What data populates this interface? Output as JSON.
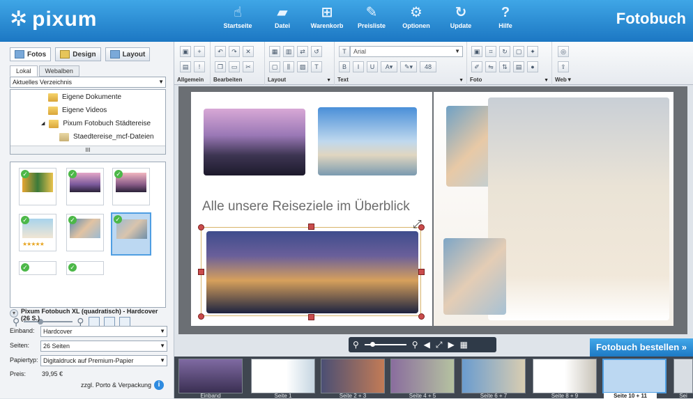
{
  "app": {
    "logo": "pixum",
    "brand": "Fotobuch"
  },
  "nav": [
    {
      "label": "Startseite",
      "icon": "hand-pointer-icon"
    },
    {
      "label": "Datei",
      "icon": "folder-icon"
    },
    {
      "label": "Warenkorb",
      "icon": "cart-icon"
    },
    {
      "label": "Preisliste",
      "icon": "price-tag-icon"
    },
    {
      "label": "Optionen",
      "icon": "gears-icon"
    },
    {
      "label": "Update",
      "icon": "refresh-icon"
    },
    {
      "label": "Hilfe",
      "icon": "question-icon"
    }
  ],
  "sidebar": {
    "tabs": [
      "Fotos",
      "Design",
      "Layout"
    ],
    "subtabs": [
      "Lokal",
      "Webalben"
    ],
    "directory": "Aktuelles Verzeichnis",
    "tree": [
      "Eigene Dokumente",
      "Eigene Videos",
      "Pixum Fotobuch Städtereise",
      "Staedtereise_mcf-Dateien"
    ],
    "scroll_mid": "III"
  },
  "product": {
    "title": "Pixum Fotobuch XL (quadratisch) - Hardcover (26 S.)",
    "einband_label": "Einband:",
    "einband_value": "Hardcover",
    "seiten_label": "Seiten:",
    "seiten_value": "26 Seiten",
    "papier_label": "Papiertyp:",
    "papier_value": "Digitaldruck auf Premium-Papier",
    "preis_label": "Preis:",
    "preis_value": "39,95 €",
    "porto": "zzgl. Porto & Verpackung"
  },
  "toolbar": {
    "groups": [
      "Allgemein",
      "Bearbeiten",
      "Layout",
      "Text",
      "Foto",
      "Web"
    ],
    "font": "Arial",
    "fontsize": "48"
  },
  "page": {
    "title_text": "Alle unsere Reiseziele im Überblick"
  },
  "order_button": "Fotobuch bestellen »",
  "pages": [
    "Einband",
    "Seite 1",
    "Seite 2 + 3",
    "Seite 4 + 5",
    "Seite 6 + 7",
    "Seite 8 + 9",
    "Seite 10 + 11",
    "Sei"
  ],
  "colors": {
    "accent": "#1c77c3",
    "selection": "#4f9ee2",
    "check": "#4cb848"
  }
}
